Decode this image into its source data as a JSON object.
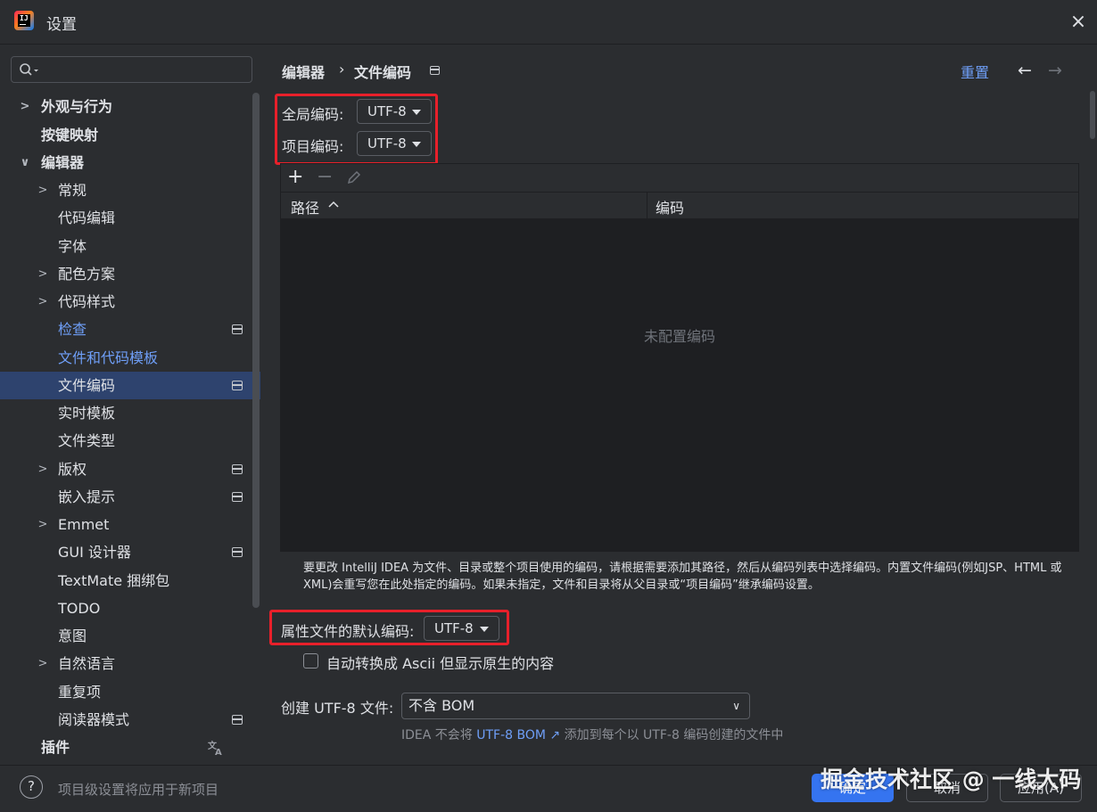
{
  "window": {
    "title": "设置",
    "close_icon": "×"
  },
  "sidebar": {
    "search_placeholder": "",
    "items": [
      {
        "label": "外观与行为",
        "expandable": true
      },
      {
        "label": "按键映射"
      },
      {
        "label": "编辑器",
        "expanded": true
      },
      {
        "label": "常规",
        "expandable": true
      },
      {
        "label": "代码编辑"
      },
      {
        "label": "字体"
      },
      {
        "label": "配色方案",
        "expandable": true
      },
      {
        "label": "代码样式",
        "expandable": true
      },
      {
        "label": "检查"
      },
      {
        "label": "文件和代码模板"
      },
      {
        "label": "文件编码",
        "selected": true
      },
      {
        "label": "实时模板"
      },
      {
        "label": "文件类型"
      },
      {
        "label": "版权",
        "expandable": true
      },
      {
        "label": "嵌入提示"
      },
      {
        "label": "Emmet",
        "expandable": true
      },
      {
        "label": "GUI 设计器"
      },
      {
        "label": "TextMate 捆绑包"
      },
      {
        "label": "TODO"
      },
      {
        "label": "意图"
      },
      {
        "label": "自然语言",
        "expandable": true
      },
      {
        "label": "重复项"
      },
      {
        "label": "阅读器模式"
      },
      {
        "label": "插件"
      }
    ]
  },
  "breadcrumb": {
    "section": "编辑器",
    "separator": "›",
    "page": "文件编码"
  },
  "header": {
    "reset": "重置",
    "back_icon": "←",
    "forward_icon": "→"
  },
  "encoding": {
    "global_label": "全局编码:",
    "global_value": "UTF-8",
    "project_label": "项目编码:",
    "project_value": "UTF-8"
  },
  "table": {
    "add_icon": "+",
    "remove_icon": "−",
    "columns": [
      "路径",
      "编码"
    ],
    "empty_text": "未配置编码"
  },
  "description": "要更改 IntelliJ IDEA 为文件、目录或整个项目使用的编码，请根据需要添加其路径，然后从编码列表中选择编码。内置文件编码(例如JSP、HTML 或 XML)会重写您在此处指定的编码。如果未指定，文件和目录将从父目录或“项目编码”继承编码设置。",
  "properties": {
    "label": "属性文件的默认编码:",
    "value": "UTF-8",
    "ascii_label": "自动转换成 Ascii 但显示原生的内容",
    "ascii_checked": false
  },
  "bom": {
    "label": "创建 UTF-8 文件:",
    "value": "不含 BOM",
    "hint_prefix": "IDEA 不会将",
    "hint_link": "UTF-8 BOM ↗",
    "hint_suffix": "添加到每个以 UTF-8 编码创建的文件中"
  },
  "footer": {
    "help_icon": "?",
    "note": "项目级设置将应用于新项目",
    "ok": "确定",
    "cancel": "取消",
    "apply": "应用(A)"
  },
  "watermark": "掘金技术社区 @ 一线大码",
  "colors": {
    "accent": "#3574f0",
    "link": "#6f9ff8",
    "highlight_box": "#e8202a",
    "selection": "#2e436e"
  }
}
